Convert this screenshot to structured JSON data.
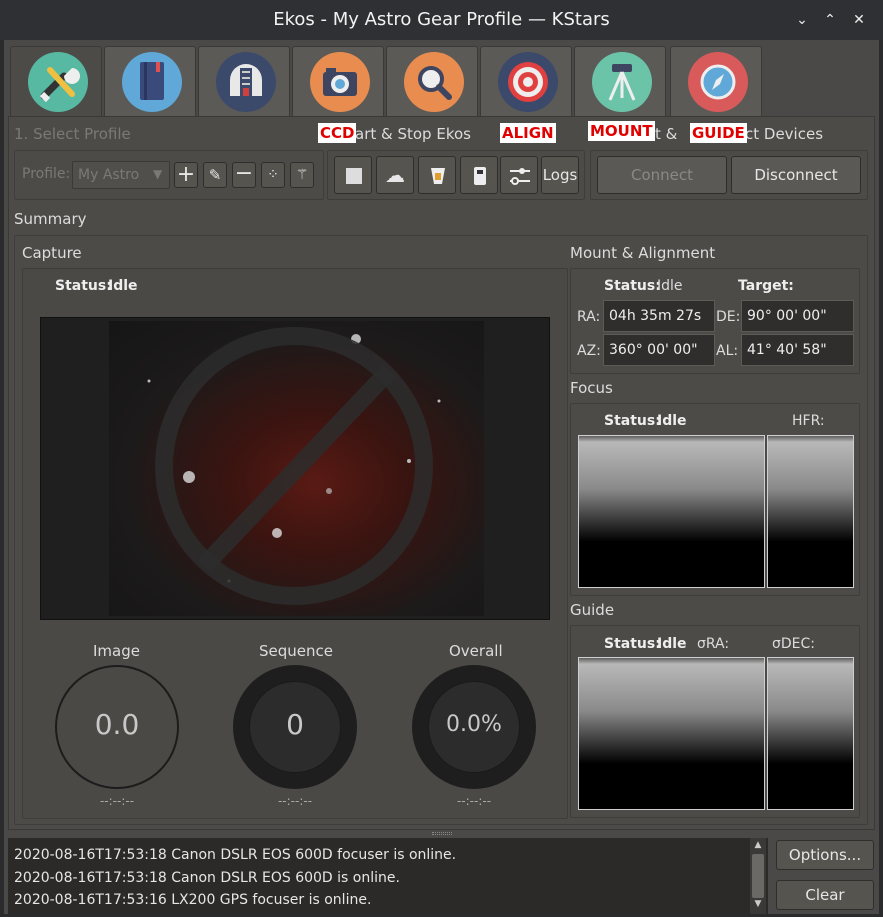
{
  "window": {
    "title": "Ekos - My Astro Gear Profile — KStars"
  },
  "tabs": [
    {
      "name": "setup"
    },
    {
      "name": "scheduler"
    },
    {
      "name": "observatory"
    },
    {
      "name": "capture"
    },
    {
      "name": "focus"
    },
    {
      "name": "align"
    },
    {
      "name": "mount"
    },
    {
      "name": "guide"
    }
  ],
  "annotations": {
    "ccd": "CCD",
    "align": "ALIGN",
    "mount": "MOUNT",
    "guide": "GUIDE"
  },
  "profile": {
    "section_label": "1. Select Profile",
    "profile_label": "Profile:",
    "selected": "My Astro"
  },
  "start_stop": {
    "section_label_partial": "art & Stop Ekos",
    "logs_label": "Logs"
  },
  "connect": {
    "section_label_a": "t & ",
    "section_label_b": "ct Devices",
    "connect_label": "Connect",
    "disconnect_label": "Disconnect"
  },
  "summary": {
    "label": "Summary"
  },
  "capture": {
    "label": "Capture",
    "status_key": "Status:",
    "status_value": "Idle",
    "image_label": "Image",
    "image_value": "0.0",
    "image_time": "--:--:--",
    "sequence_label": "Sequence",
    "sequence_value": "0",
    "sequence_time": "--:--:--",
    "overall_label": "Overall",
    "overall_value": "0.0%",
    "overall_time": "--:--:--"
  },
  "mount": {
    "label": "Mount & Alignment",
    "status_key": "Status:",
    "status_value": "Idle",
    "target_label": "Target:",
    "ra_label": "RA:",
    "ra_value": "04h 35m 27s",
    "de_label": "DE:",
    "de_value": "90° 00' 00\"",
    "az_label": "AZ:",
    "az_value": "360° 00' 00\"",
    "al_label": "AL:",
    "al_value": "41° 40' 58\""
  },
  "focus": {
    "label": "Focus",
    "status_key": "Status:",
    "status_value": "Idle",
    "hfr_label": "HFR:"
  },
  "guide": {
    "label": "Guide",
    "status_key": "Status:",
    "status_value": "Idle",
    "ra_label": "σRA:",
    "dec_label": "σDEC:"
  },
  "log": {
    "lines": [
      "2020-08-16T17:53:18 Canon DSLR EOS 600D focuser is online.",
      "2020-08-16T17:53:18 Canon DSLR EOS 600D is online.",
      "2020-08-16T17:53:16 LX200 GPS focuser is online."
    ],
    "options_label": "Options...",
    "clear_label": "Clear"
  }
}
